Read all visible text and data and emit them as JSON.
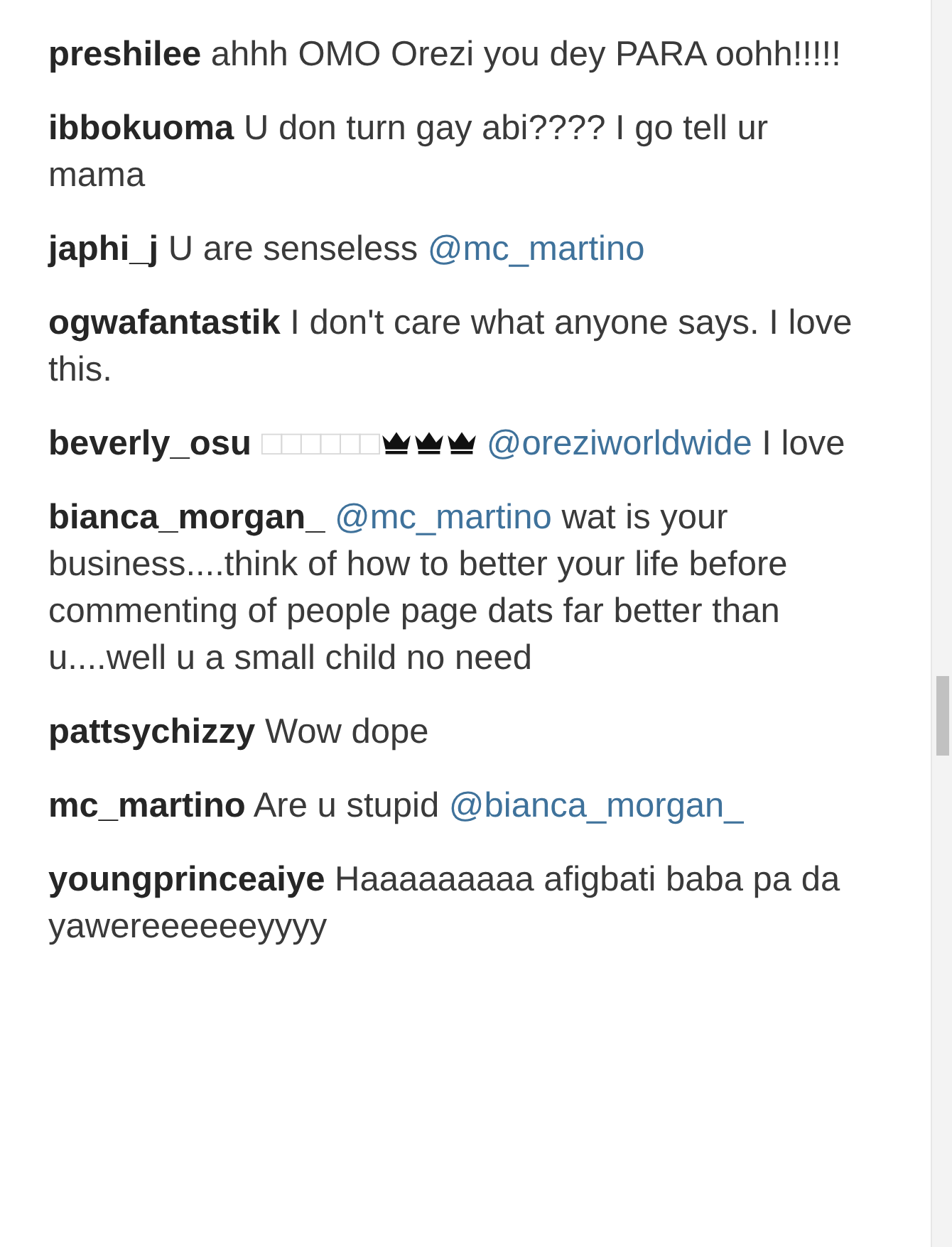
{
  "comments": [
    {
      "username": "preshilee",
      "parts": [
        {
          "kind": "text",
          "text": "ahhh OMO Orezi you dey PARA oohh!!!!!"
        }
      ]
    },
    {
      "username": "ibbokuoma",
      "parts": [
        {
          "kind": "text",
          "text": "U don turn gay abi???? I go tell ur mama"
        }
      ]
    },
    {
      "username": "japhi_j",
      "parts": [
        {
          "kind": "text",
          "text": "U are senseless"
        },
        {
          "kind": "mention",
          "text": "@mc_martino"
        }
      ]
    },
    {
      "username": "ogwafantastik",
      "parts": [
        {
          "kind": "text",
          "text": "I don't care what anyone says. I love this."
        }
      ]
    },
    {
      "username": "beverly_osu",
      "parts": [
        {
          "kind": "missing",
          "text": "□□□□□□"
        },
        {
          "kind": "crown"
        },
        {
          "kind": "crown"
        },
        {
          "kind": "crown"
        },
        {
          "kind": "mention",
          "text": "@oreziworldwide"
        },
        {
          "kind": "text",
          "text": "I love"
        }
      ]
    },
    {
      "username": "bianca_morgan_",
      "parts": [
        {
          "kind": "mention",
          "text": "@mc_martino"
        },
        {
          "kind": "text",
          "text": "wat is your business....think of how to better your life before commenting of people page dats far better than u....well u a small child no need"
        }
      ]
    },
    {
      "username": "pattsychizzy",
      "parts": [
        {
          "kind": "text",
          "text": "Wow dope"
        }
      ]
    },
    {
      "username": "mc_martino",
      "parts": [
        {
          "kind": "text",
          "text": "Are u stupid"
        },
        {
          "kind": "mention",
          "text": "@bianca_morgan_"
        }
      ]
    },
    {
      "username": "youngprinceaiye",
      "parts": [
        {
          "kind": "text",
          "text": "Haaaaaaaaa afigbati baba pa da yawereeeeeeyyyy"
        }
      ]
    }
  ]
}
